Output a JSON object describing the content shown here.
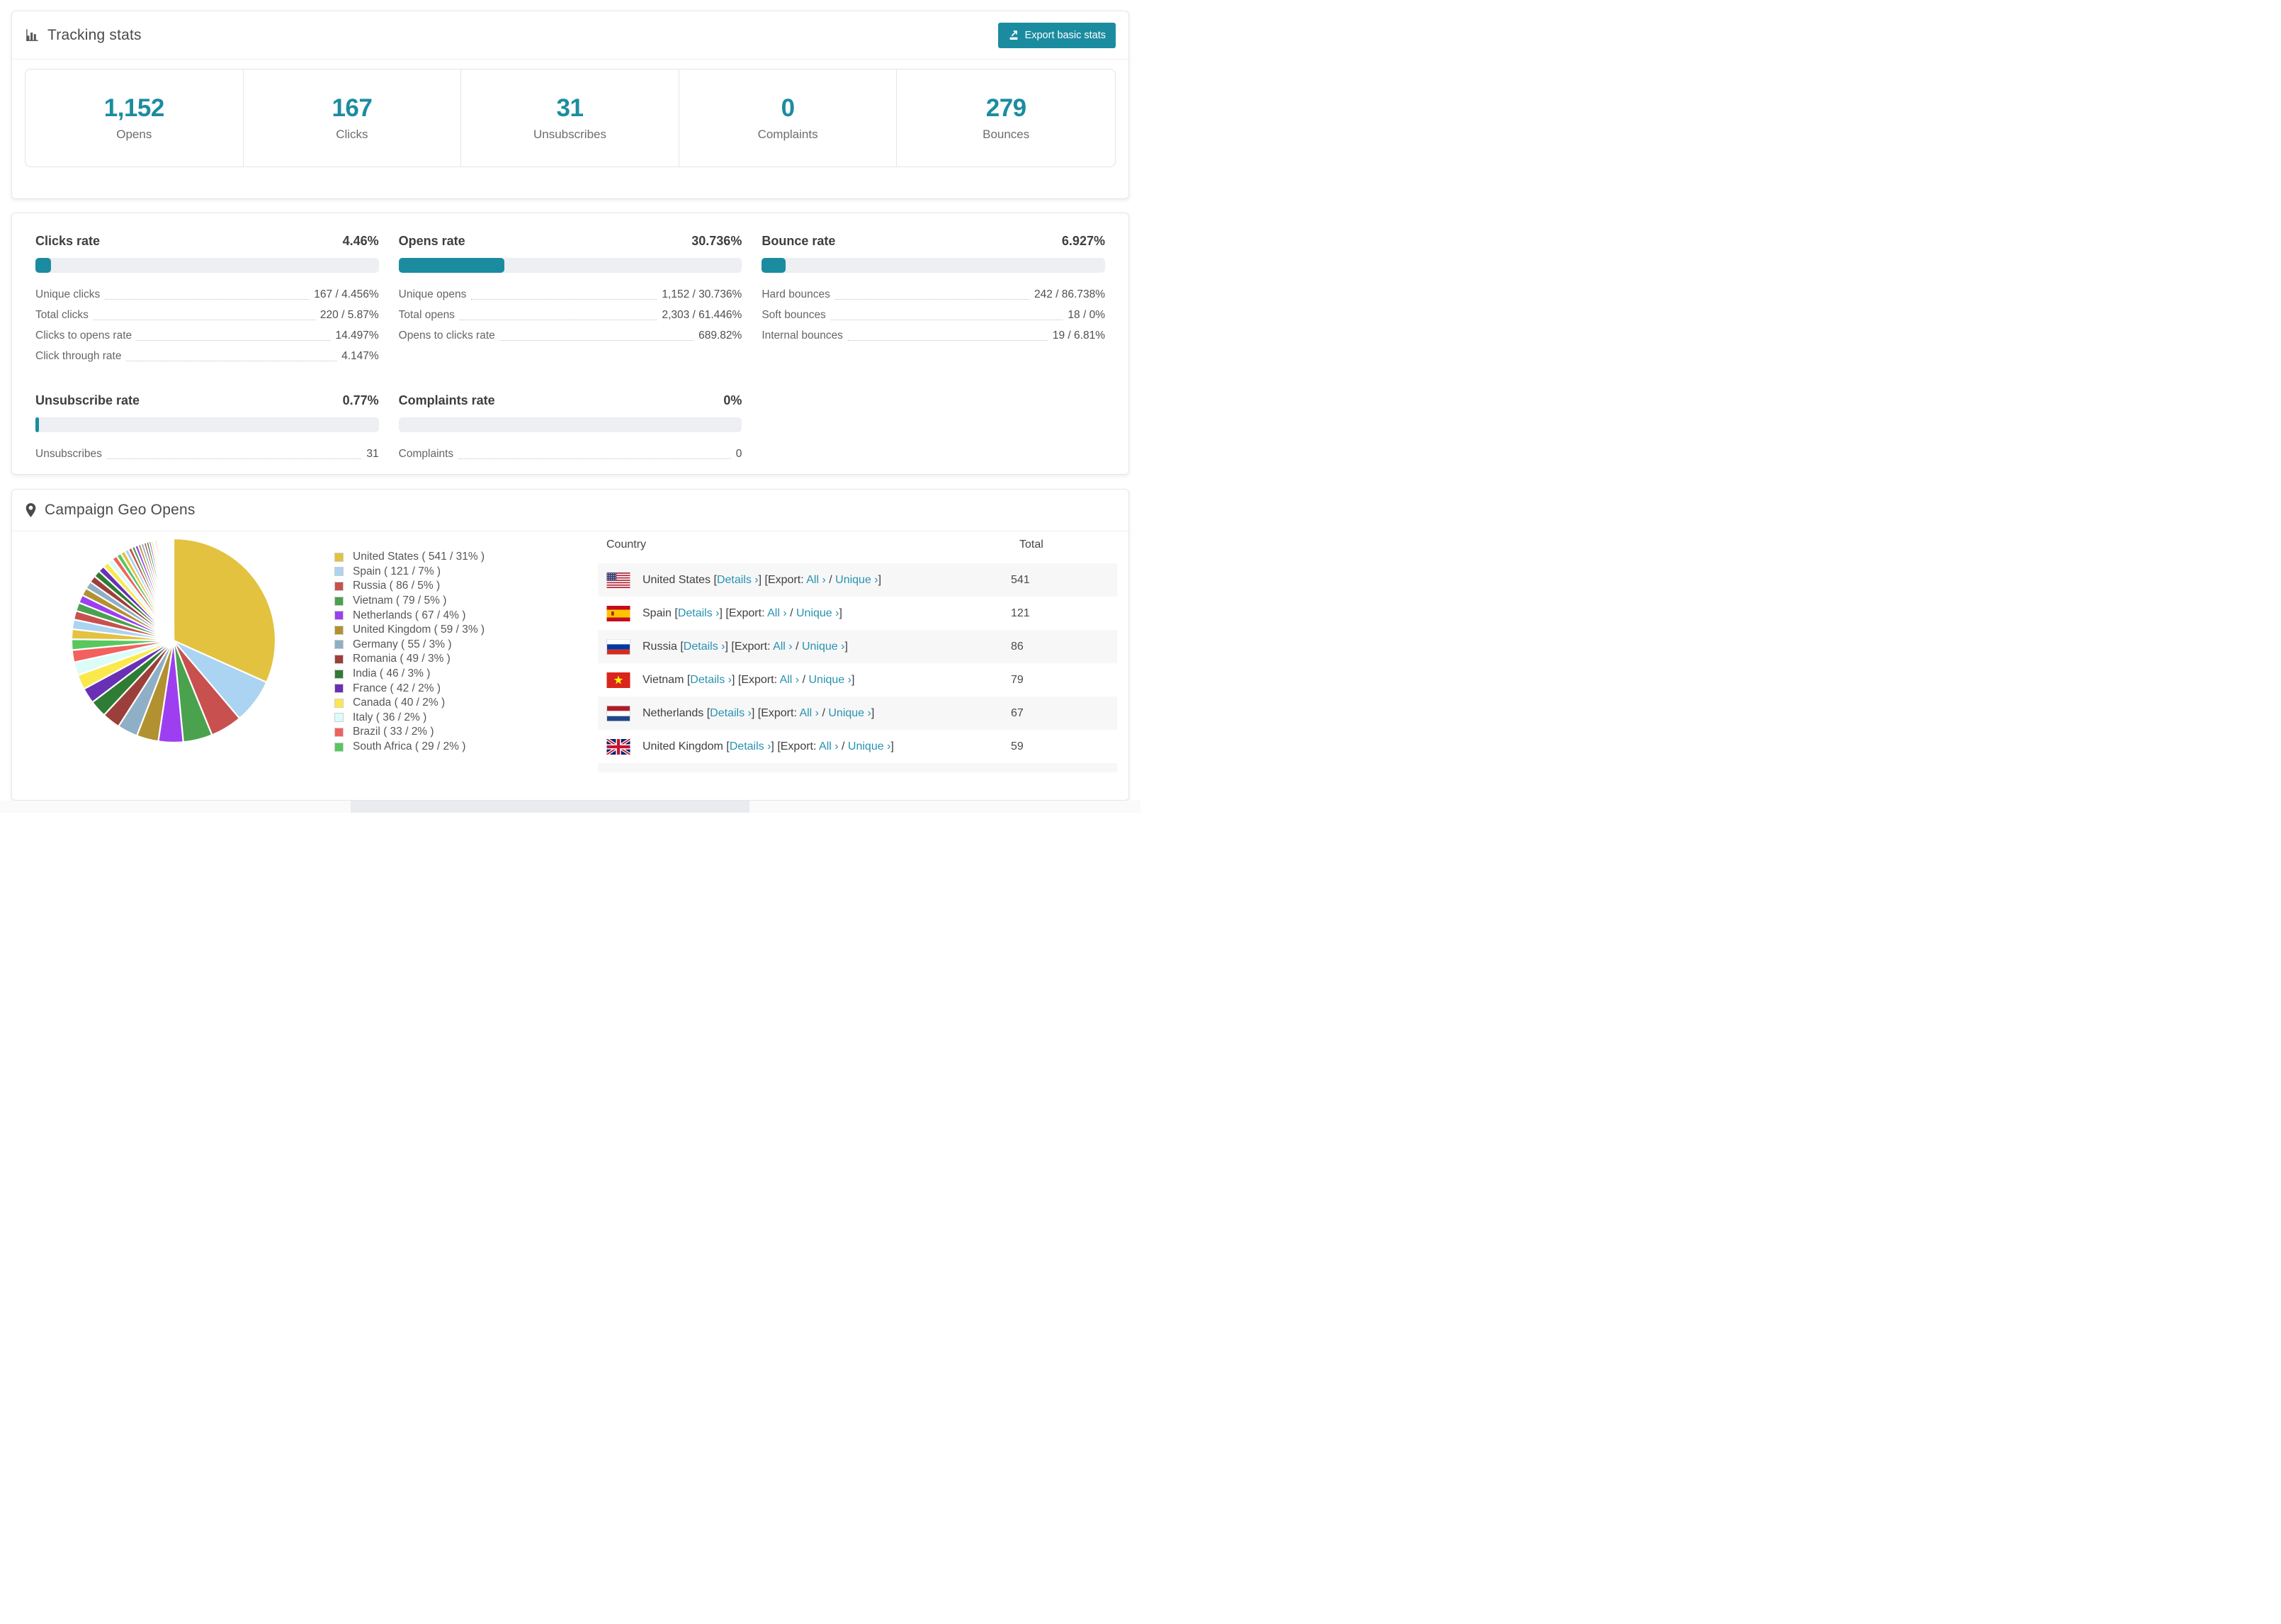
{
  "colors": {
    "accent": "#1b8ca0",
    "link": "#2893b0",
    "bar_bg": "#edeff2"
  },
  "tracking": {
    "title": "Tracking stats",
    "export_label": "Export basic stats",
    "stats": [
      {
        "value": "1,152",
        "label": "Opens"
      },
      {
        "value": "167",
        "label": "Clicks"
      },
      {
        "value": "31",
        "label": "Unsubscribes"
      },
      {
        "value": "0",
        "label": "Complaints"
      },
      {
        "value": "279",
        "label": "Bounces"
      }
    ]
  },
  "rates": [
    {
      "title": "Clicks rate",
      "value": "4.46%",
      "percent": 4.46,
      "rows": [
        {
          "label": "Unique clicks",
          "value": "167 / 4.456%"
        },
        {
          "label": "Total clicks",
          "value": "220 / 5.87%"
        },
        {
          "label": "Clicks to opens rate",
          "value": "14.497%"
        },
        {
          "label": "Click through rate",
          "value": "4.147%"
        }
      ]
    },
    {
      "title": "Opens rate",
      "value": "30.736%",
      "percent": 30.736,
      "rows": [
        {
          "label": "Unique opens",
          "value": "1,152 / 30.736%"
        },
        {
          "label": "Total opens",
          "value": "2,303 / 61.446%"
        },
        {
          "label": "Opens to clicks rate",
          "value": "689.82%"
        }
      ]
    },
    {
      "title": "Bounce rate",
      "value": "6.927%",
      "percent": 6.927,
      "rows": [
        {
          "label": "Hard bounces",
          "value": "242 / 86.738%"
        },
        {
          "label": "Soft bounces",
          "value": "18 / 0%"
        },
        {
          "label": "Internal bounces",
          "value": "19 / 6.81%"
        }
      ]
    },
    {
      "title": "Unsubscribe rate",
      "value": "0.77%",
      "percent": 0.77,
      "rows": [
        {
          "label": "Unsubscribes",
          "value": "31"
        }
      ]
    },
    {
      "title": "Complaints rate",
      "value": "0%",
      "percent": 0,
      "rows": [
        {
          "label": "Complaints",
          "value": "0"
        }
      ]
    }
  ],
  "geo": {
    "title": "Campaign Geo Opens",
    "table": {
      "headers": [
        "Country",
        "Total"
      ],
      "bracket_open": "[",
      "bracket_close": "]",
      "export_prefix": "[Export:",
      "details_label": "Details ›",
      "all_label": "All ›",
      "unique_label": "Unique ›",
      "slash": "/",
      "rows": [
        {
          "country": "United States",
          "flag": "us",
          "total": "541"
        },
        {
          "country": "Spain",
          "flag": "es",
          "total": "121"
        },
        {
          "country": "Russia",
          "flag": "ru",
          "total": "86"
        },
        {
          "country": "Vietnam",
          "flag": "vn",
          "total": "79"
        },
        {
          "country": "Netherlands",
          "flag": "nl",
          "total": "67"
        },
        {
          "country": "United Kingdom",
          "flag": "gb",
          "total": "59"
        }
      ],
      "partial_row": {
        "flag": "de"
      }
    }
  },
  "chart_data": {
    "type": "pie",
    "title": "Campaign Geo Opens",
    "legend_position": "right",
    "legend_label_format": "{name} ( {value} / {pct} )",
    "series": [
      {
        "name": "United States",
        "value": 541,
        "pct": "31%",
        "color": "#e2c23f"
      },
      {
        "name": "Spain",
        "value": 121,
        "pct": "7%",
        "color": "#abd3f2"
      },
      {
        "name": "Russia",
        "value": 86,
        "pct": "5%",
        "color": "#c8504e"
      },
      {
        "name": "Vietnam",
        "value": 79,
        "pct": "5%",
        "color": "#4aa24e"
      },
      {
        "name": "Netherlands",
        "value": 67,
        "pct": "4%",
        "color": "#9d3ff0"
      },
      {
        "name": "United Kingdom",
        "value": 59,
        "pct": "3%",
        "color": "#b29130"
      },
      {
        "name": "Germany",
        "value": 55,
        "pct": "3%",
        "color": "#8eafc6"
      },
      {
        "name": "Romania",
        "value": 49,
        "pct": "3%",
        "color": "#9c3f3b"
      },
      {
        "name": "India",
        "value": 46,
        "pct": "3%",
        "color": "#2f7c34"
      },
      {
        "name": "France",
        "value": 42,
        "pct": "2%",
        "color": "#6930b5"
      },
      {
        "name": "Canada",
        "value": 40,
        "pct": "2%",
        "color": "#fbe84d"
      },
      {
        "name": "Italy",
        "value": 36,
        "pct": "2%",
        "color": "#dcfcf7"
      },
      {
        "name": "Brazil",
        "value": 33,
        "pct": "2%",
        "color": "#f2615f"
      },
      {
        "name": "South Africa",
        "value": 29,
        "pct": "2%",
        "color": "#57c75e"
      }
    ],
    "others_small_slices": [
      27,
      26,
      24,
      23,
      22,
      21,
      20,
      19,
      18,
      17,
      16,
      15,
      14,
      13,
      12,
      11,
      10,
      9,
      9,
      8,
      8,
      7,
      7,
      6,
      6,
      5,
      5,
      4,
      4,
      4,
      3,
      3,
      3,
      3,
      2,
      2,
      2,
      2,
      2,
      1,
      1,
      1,
      1,
      1,
      1,
      1,
      1,
      1,
      1,
      1
    ]
  }
}
